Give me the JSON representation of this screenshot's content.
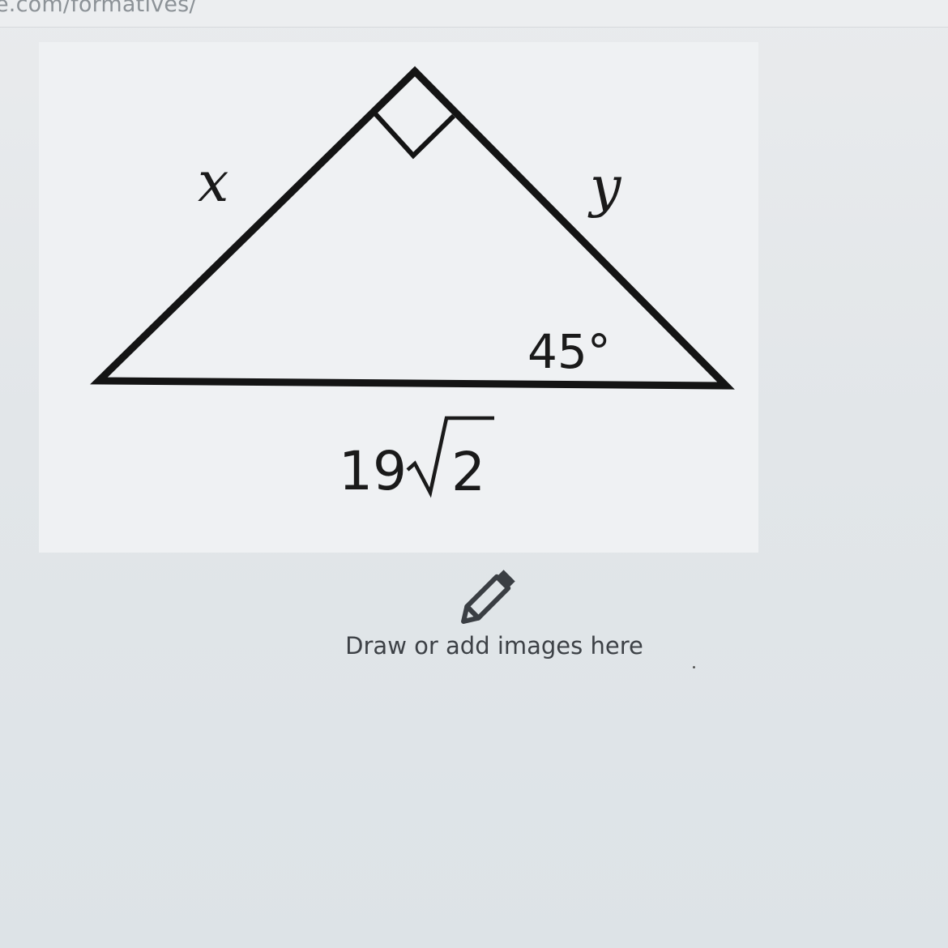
{
  "browser": {
    "url_fragment": "e.com/formatives/"
  },
  "figure": {
    "side_left_label": "x",
    "side_right_label": "y",
    "angle_label": "45°",
    "hypotenuse_coefficient": "19",
    "hypotenuse_radicand": "2"
  },
  "draw_prompt": {
    "label": "Draw or add images here",
    "icon": "pencil-icon"
  }
}
